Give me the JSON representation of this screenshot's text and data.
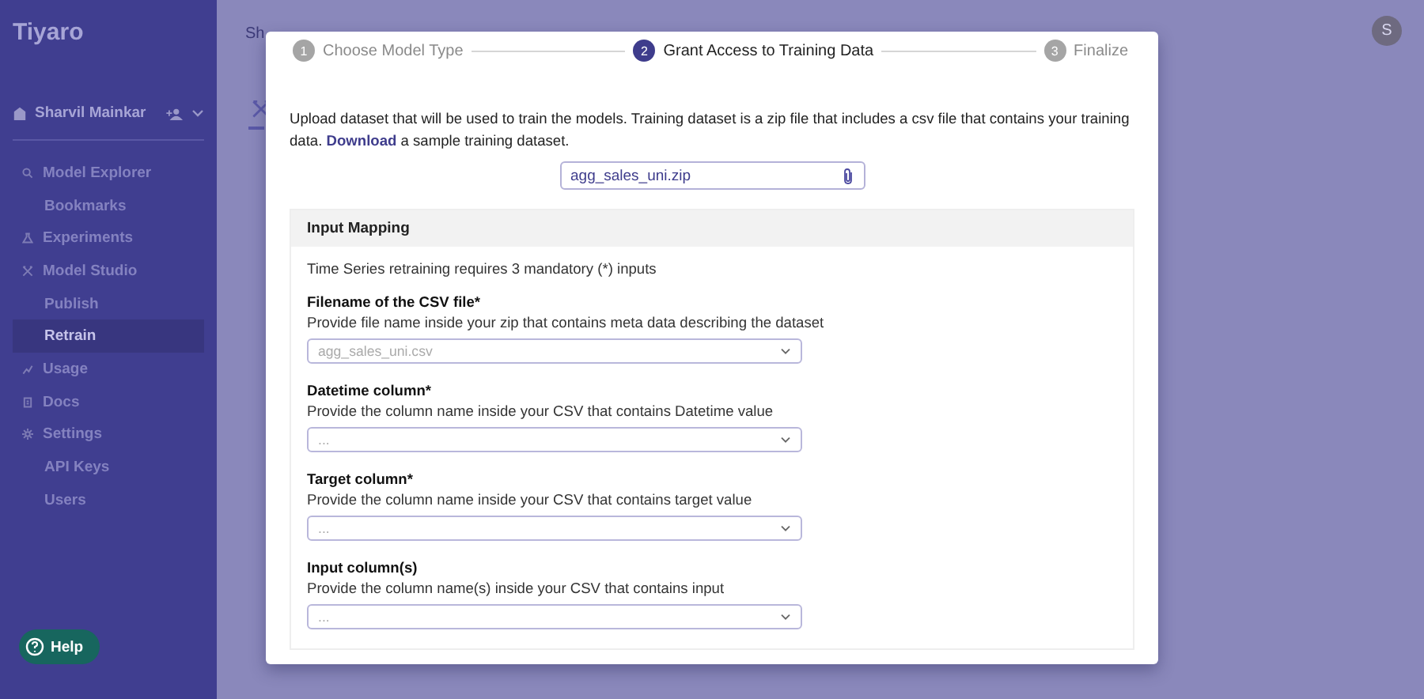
{
  "app": {
    "logo": "Tiyaro",
    "avatar": "S",
    "breadcrumb_visible": "Sh"
  },
  "sidebar": {
    "user": "Sharvil Mainkar",
    "items": [
      {
        "label": "Model Explorer",
        "selected": false,
        "children": [
          {
            "label": "Bookmarks",
            "selected": false
          }
        ]
      },
      {
        "label": "Experiments",
        "selected": false
      },
      {
        "label": "Model Studio",
        "selected": false,
        "children": [
          {
            "label": "Publish",
            "selected": false
          },
          {
            "label": "Retrain",
            "selected": true
          }
        ]
      },
      {
        "label": "Usage",
        "selected": false
      },
      {
        "label": "Docs",
        "selected": false
      },
      {
        "label": "Settings",
        "selected": false,
        "children": [
          {
            "label": "API Keys",
            "selected": false
          },
          {
            "label": "Users",
            "selected": false
          }
        ]
      }
    ],
    "help": "Help"
  },
  "modal": {
    "steps": [
      {
        "number": "1",
        "label": "Choose Model Type",
        "selected": false
      },
      {
        "number": "2",
        "label": "Grant Access to Training Data",
        "selected": true
      },
      {
        "number": "3",
        "label": "Finalize",
        "selected": false
      }
    ],
    "intro": "Upload dataset that will be used to train the models. Training dataset is a zip file that includes a csv file that contains your training data. ",
    "intro_link": "Download",
    "intro_end": " a sample training dataset.",
    "upload_value": "agg_sales_uni.zip",
    "section_title": "Input Mapping",
    "section_note": "Time Series retraining requires 3 mandatory (*) inputs",
    "fields": [
      {
        "label": "Filename of the CSV file*",
        "description": "Provide file name inside your zip that contains meta data describing the dataset",
        "placeholder": "agg_sales_uni.csv"
      },
      {
        "label": "Datetime column*",
        "description": "Provide the column name inside your CSV that contains Datetime value",
        "placeholder": "..."
      },
      {
        "label": "Target column*",
        "description": "Provide the column name inside your CSV that contains target value",
        "placeholder": "..."
      },
      {
        "label": "Input column(s)",
        "description": "Provide the column name(s) inside your CSV that contains input",
        "placeholder": "..."
      }
    ]
  }
}
